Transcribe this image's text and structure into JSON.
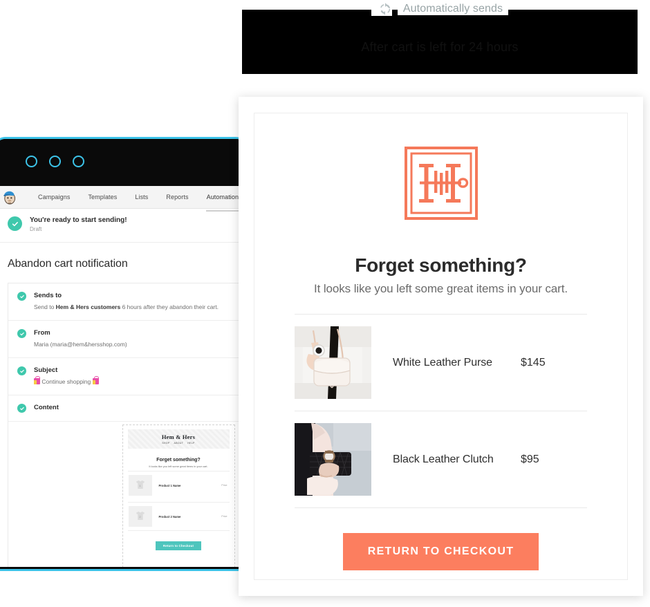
{
  "trigger": {
    "legend_label": "Automatically sends",
    "legend_icon": "sync-icon",
    "body_text": "After cart is left for 24 hours"
  },
  "browser": {
    "window_dots": [
      "dot-red",
      "dot-yellow",
      "dot-green"
    ],
    "accent_color": "#3cc3e8",
    "chrome_color": "#0a0a0a"
  },
  "app": {
    "brand_icon": "mailchimp-freddie-icon",
    "nav": [
      {
        "label": "Campaigns",
        "active": false
      },
      {
        "label": "Templates",
        "active": false
      },
      {
        "label": "Lists",
        "active": false
      },
      {
        "label": "Reports",
        "active": false
      },
      {
        "label": "Automation",
        "active": true
      }
    ],
    "status": {
      "icon": "check-circle-icon",
      "title": "You're ready to start sending!",
      "subtitle": "Draft"
    },
    "campaign_title": "Abandon cart notification",
    "settings": [
      {
        "icon": "check-circle-icon",
        "label": "Sends to",
        "value_prefix": "Send to ",
        "value_bold": "Hem & Hers customers",
        "value_suffix": " 6 hours after they abandon their cart."
      },
      {
        "icon": "check-circle-icon",
        "label": "From",
        "value": "Maria (maria@hem&hersshop.com)"
      },
      {
        "icon": "check-circle-icon",
        "label": "Subject",
        "value": "Continue shopping",
        "emoji": "shopping-bag-emoji"
      },
      {
        "icon": "check-circle-icon",
        "label": "Content",
        "value": ""
      }
    ]
  },
  "preview_thumbnail": {
    "brand": "Hem & Hers",
    "nav": [
      "SHOP",
      "ABOUT",
      "HELP"
    ],
    "headline": "Forget something?",
    "subhead": "It looks like you left some great items in your cart.",
    "products": [
      {
        "thumb_label": "1",
        "name": "Product 1 Name",
        "price": "Price"
      },
      {
        "thumb_label": "2",
        "name": "Product 2 Name",
        "price": "Price"
      }
    ],
    "cta": "Return to Checkout"
  },
  "email": {
    "logo_icon": "hem-and-hers-monogram-icon",
    "brand_color": "#fc7e5f",
    "headline": "Forget something?",
    "subhead": "It looks like you left some great items in your cart.",
    "products": [
      {
        "image": "white-leather-purse-photo",
        "name": "White Leather Purse",
        "price": "$145"
      },
      {
        "image": "black-leather-clutch-photo",
        "name": "Black Leather Clutch",
        "price": "$95"
      }
    ],
    "cta_label": "RETURN TO CHECKOUT"
  }
}
